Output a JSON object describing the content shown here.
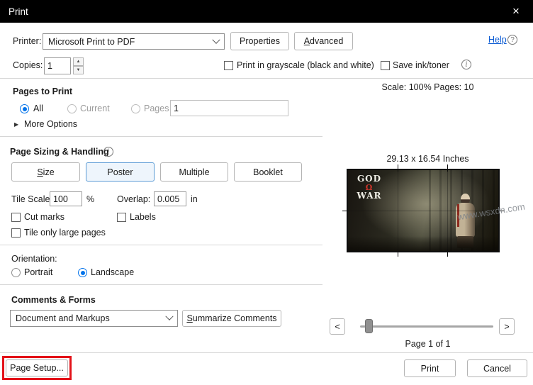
{
  "titlebar": {
    "title": "Print"
  },
  "icons": {
    "close": "×",
    "up": "▲",
    "down": "▼",
    "help_mark": "?",
    "info_mark": "i",
    "triangle": "▶"
  },
  "printer": {
    "label": "Printer:",
    "value": "Microsoft Print to PDF",
    "properties": "Properties",
    "advanced": "Advanced",
    "help": "Help"
  },
  "copies": {
    "label": "Copies:",
    "value": "1",
    "grayscale_label": "Print in grayscale (black and white)",
    "save_ink_label": "Save ink/toner"
  },
  "pages_to_print": {
    "heading": "Pages to Print",
    "all_label": "All",
    "current_label": "Current",
    "pages_label": "Pages",
    "range_value": "1",
    "more_options": "More Options"
  },
  "sizing": {
    "heading": "Page Sizing & Handling",
    "size": "Size",
    "poster": "Poster",
    "multiple": "Multiple",
    "booklet": "Booklet",
    "tile_scale_label": "Tile Scale:",
    "tile_scale_value": "100",
    "tile_scale_unit": "%",
    "overlap_label": "Overlap:",
    "overlap_value": "0.005",
    "overlap_unit": "in",
    "cut_marks_label": "Cut marks",
    "labels_label": "Labels",
    "tile_only_label": "Tile only large pages"
  },
  "orientation": {
    "heading": "Orientation:",
    "portrait_label": "Portrait",
    "landscape_label": "Landscape"
  },
  "comments": {
    "heading": "Comments & Forms",
    "value": "Document and Markups",
    "summarize": "Summarize Comments"
  },
  "page_setup_label": "Page Setup...",
  "preview": {
    "scale_line": "Scale: 100% Pages: 10",
    "dimensions": "29.13 x 16.54 Inches",
    "page_line": "Page 1 of 1",
    "prev": "<",
    "next": ">",
    "art": {
      "god": "GOD",
      "omega": "Ω",
      "war": "WAR"
    }
  },
  "footer": {
    "print": "Print",
    "cancel": "Cancel"
  },
  "watermark": "www.wsxdn.com"
}
